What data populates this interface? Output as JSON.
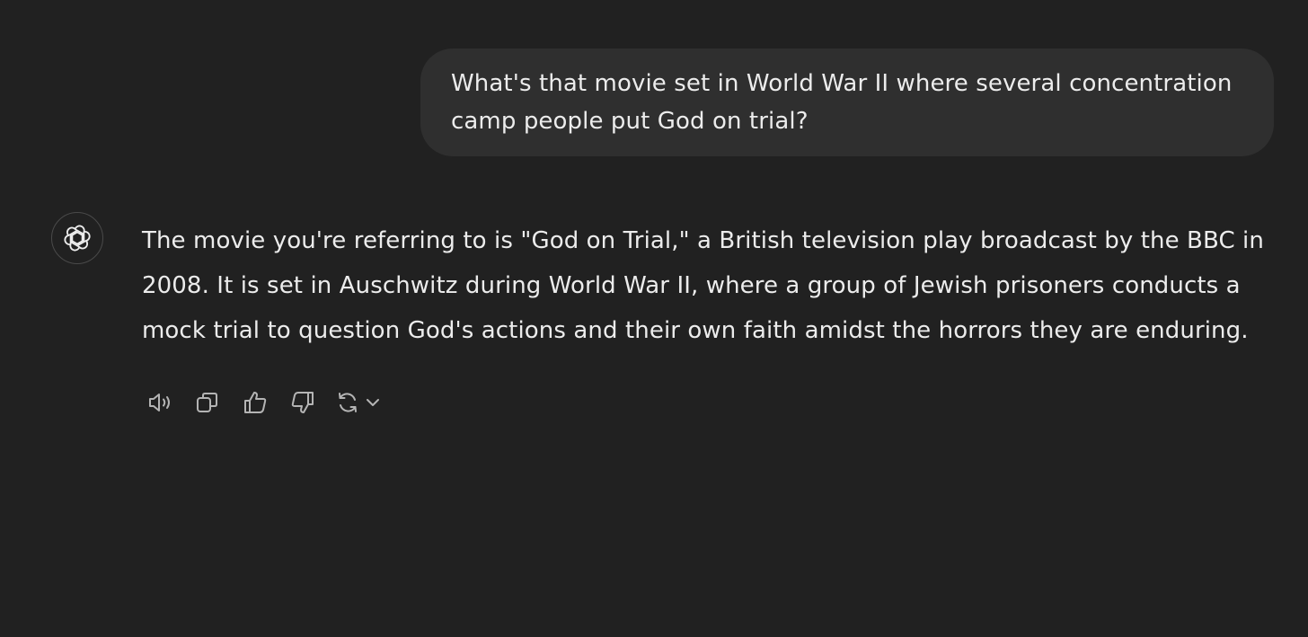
{
  "conversation": {
    "user_message": "What's that movie set in World War II where several concentration camp people put God on trial?",
    "assistant_message": "The movie you're referring to is \"God on Trial,\" a British television play broadcast by the BBC in 2008. It is set in Auschwitz during World War II, where a group of Jewish prisoners conducts a mock trial to question God's actions and their own faith amidst the horrors they are enduring.",
    "assistant_avatar_icon": "openai-logo-icon"
  },
  "actions": {
    "icons": [
      "speaker-icon",
      "copy-icon",
      "thumbs-up-icon",
      "thumbs-down-icon",
      "regenerate-icon",
      "chevron-down-icon"
    ]
  },
  "colors": {
    "background": "#212121",
    "user_bubble": "#2f2f2f",
    "text": "#ececec",
    "icon": "#b4b4b4"
  }
}
